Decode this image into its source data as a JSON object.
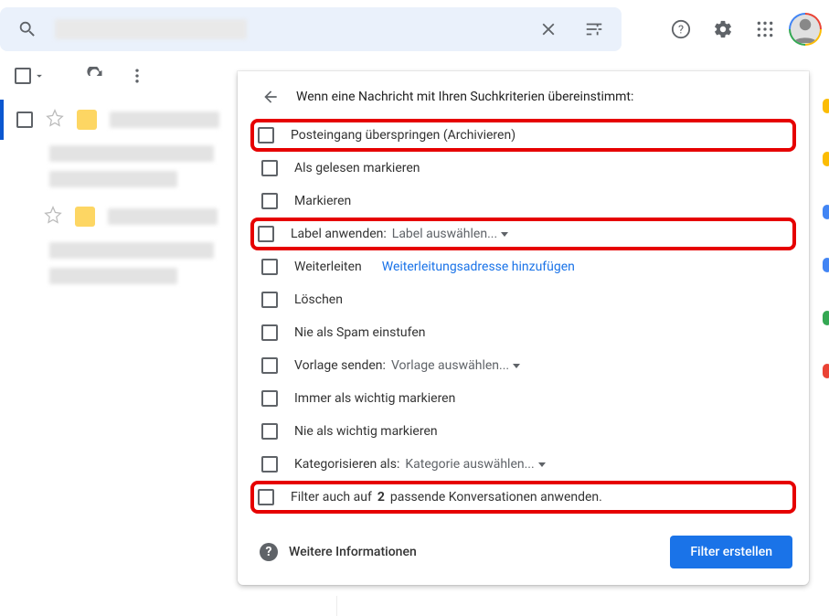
{
  "search": {
    "placeholder": ""
  },
  "topbar_icons": {
    "search": "search-icon",
    "clear": "close-icon",
    "tune": "tune-icon",
    "help": "help-icon",
    "settings": "gear-icon",
    "apps": "apps-icon"
  },
  "filter_panel": {
    "header": "Wenn eine Nachricht mit Ihren Suchkriterien übereinstimmt:",
    "rows": [
      {
        "label": "Posteingang überspringen (Archivieren)",
        "highlighted": true
      },
      {
        "label": "Als gelesen markieren"
      },
      {
        "label": "Markieren"
      },
      {
        "label_pre": "Label anwenden:",
        "select": "Label auswählen...",
        "highlighted": true
      },
      {
        "label": "Weiterleiten",
        "link": "Weiterleitungsadresse hinzufügen"
      },
      {
        "label": "Löschen"
      },
      {
        "label": "Nie als Spam einstufen"
      },
      {
        "label_pre": "Vorlage senden:",
        "select": "Vorlage auswählen..."
      },
      {
        "label": "Immer als wichtig markieren"
      },
      {
        "label": "Nie als wichtig markieren"
      },
      {
        "label_pre": "Kategorisieren als:",
        "select": "Kategorie auswählen..."
      },
      {
        "label_pre": "Filter auch auf",
        "bold": "2",
        "label_post": "passende Konversationen anwenden.",
        "highlighted": true
      }
    ],
    "learn_more": "Weitere Informationen",
    "submit": "Filter erstellen"
  }
}
